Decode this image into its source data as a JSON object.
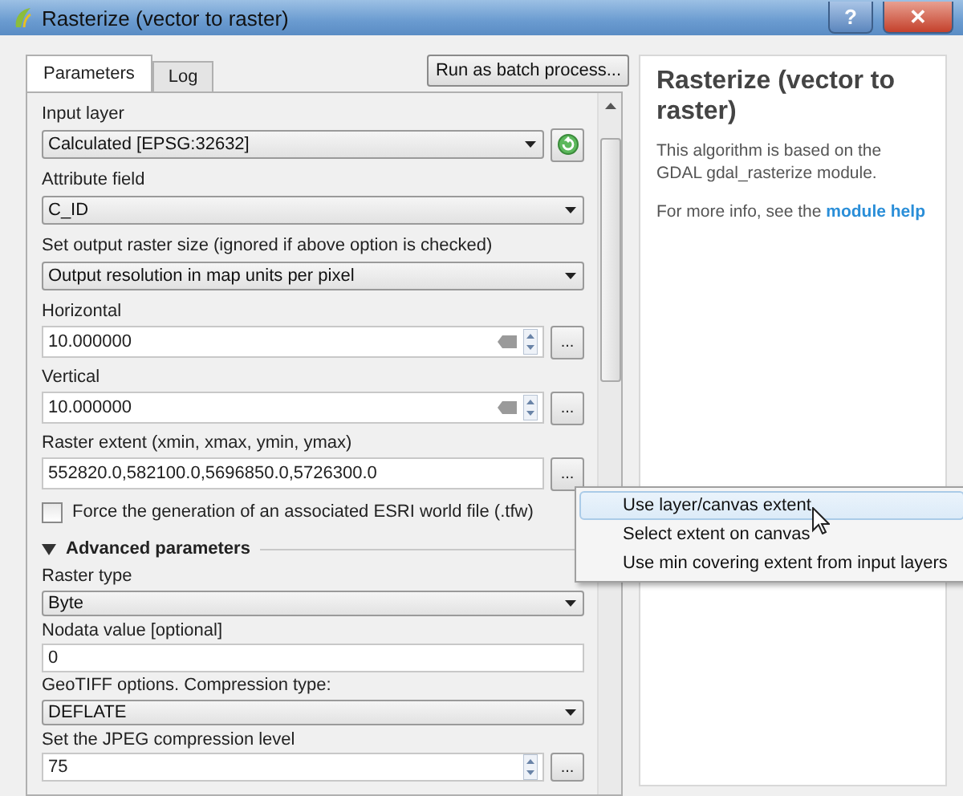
{
  "window": {
    "title": "Rasterize (vector to raster)",
    "help": "?",
    "close": "✕"
  },
  "tabs": [
    {
      "label": "Parameters",
      "selected": true
    },
    {
      "label": "Log",
      "selected": false
    }
  ],
  "batch_button": "Run as batch process...",
  "fields": [
    {
      "kind": "combo",
      "label": "Input layer",
      "value": "Calculated [EPSG:32632]",
      "side": {
        "kind": "refresh"
      }
    },
    {
      "kind": "combo",
      "label": "Attribute field",
      "value": "C_ID"
    },
    {
      "kind": "combo",
      "label": "Set output raster size (ignored if above option is checked)",
      "value": "Output resolution in map units per pixel"
    },
    {
      "kind": "spin",
      "label": "Horizontal",
      "value": "10.000000",
      "clearable": true,
      "side": {
        "kind": "ellipsis",
        "label": "..."
      }
    },
    {
      "kind": "spin",
      "label": "Vertical",
      "value": "10.000000",
      "clearable": true,
      "side": {
        "kind": "ellipsis",
        "label": "..."
      }
    },
    {
      "kind": "text",
      "label": "Raster extent (xmin, xmax, ymin, ymax)",
      "value": "552820.0,582100.0,5696850.0,5726300.0",
      "side": {
        "kind": "ellipsis",
        "label": "..."
      }
    },
    {
      "kind": "checkbox",
      "label": "Force the generation of an associated ESRI world file (.tfw)",
      "checked": false
    },
    {
      "kind": "section",
      "label": "Advanced parameters",
      "expanded": true,
      "children": [
        {
          "kind": "combo",
          "label": "Raster type",
          "value": "Byte"
        },
        {
          "kind": "text",
          "label": "Nodata value [optional]",
          "value": "0"
        },
        {
          "kind": "combo",
          "label": "GeoTIFF options. Compression type:",
          "value": "DEFLATE"
        },
        {
          "kind": "spin",
          "label": "Set the JPEG compression level",
          "value": "75",
          "clearable": false,
          "side": {
            "kind": "ellipsis",
            "label": "..."
          }
        }
      ]
    }
  ],
  "help_panel": {
    "title": "Rasterize (vector to raster)",
    "description": "This algorithm is based on the GDAL gdal_rasterize module.",
    "more_info": "For more info, see the",
    "link": "module help"
  },
  "menu": [
    {
      "label": "Use layer/canvas extent",
      "selected": true
    },
    {
      "label": "Select extent on canvas",
      "selected": false
    },
    {
      "label": "Use min covering extent from input layers",
      "selected": false
    }
  ]
}
